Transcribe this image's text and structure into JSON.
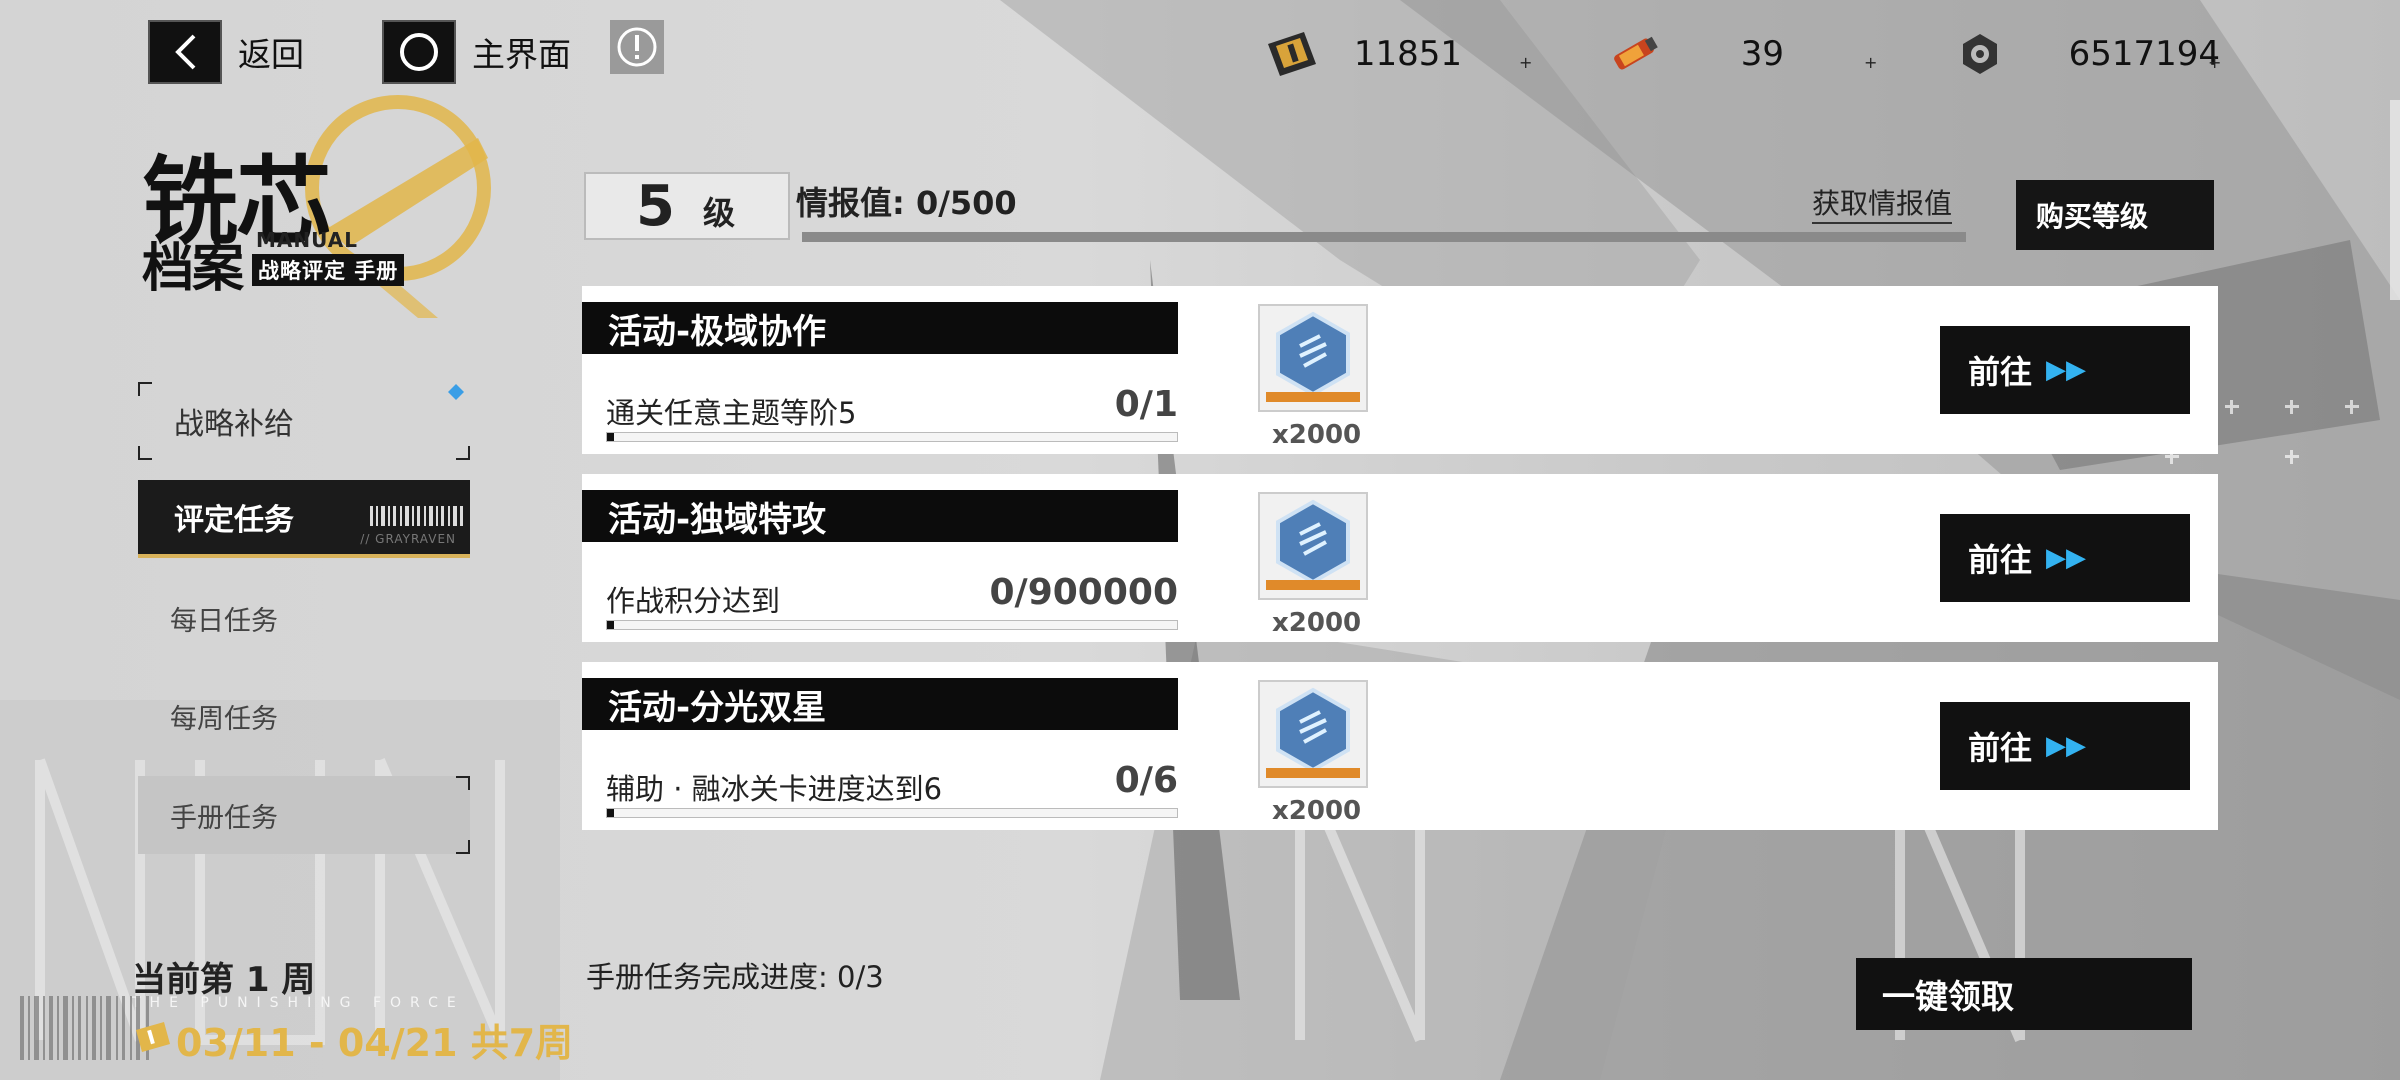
{
  "topbar": {
    "back_label": "返回",
    "home_label": "主界面",
    "resources": [
      {
        "icon": "ticket-icon",
        "value": "11851"
      },
      {
        "icon": "serum-vial-icon",
        "value": "39"
      },
      {
        "icon": "cog-coin-icon",
        "value": "6517194"
      }
    ]
  },
  "logo": {
    "title_line1": "铣芯",
    "title_line2": "档案",
    "manual": "MANUAL",
    "subtitle": "战略评定 手册"
  },
  "nav": {
    "supply": "战略补给",
    "eval": "评定任务",
    "eval_deco": "// GRAYRAVEN",
    "daily": "每日任务",
    "weekly": "每周任务",
    "manual": "手册任务"
  },
  "level": {
    "number": "5",
    "unit": "级",
    "intel_label": "情报值: 0/500",
    "intel_fraction": 0,
    "get_intel": "获取情报值",
    "buy_level": "购买等级"
  },
  "tasks": [
    {
      "title": "活动-极域协作",
      "desc": "通关任意主题等阶5",
      "progress": "0/1",
      "progress_fraction": 0,
      "reward_qty": "x2000",
      "go": "前往"
    },
    {
      "title": "活动-独域特攻",
      "desc": "作战积分达到",
      "progress": "0/900000",
      "progress_fraction": 0,
      "reward_qty": "x2000",
      "go": "前往"
    },
    {
      "title": "活动-分光双星",
      "desc": "辅助 · 融冰关卡进度达到6",
      "progress": "0/6",
      "progress_fraction": 0,
      "reward_qty": "x2000",
      "go": "前往"
    }
  ],
  "reward_icon": "supply-hexagon-icon",
  "footer": {
    "week_now": "当前第 1 周",
    "brand_tag": "THE PUNISHING FORCE",
    "dates": "03/11 - 04/21 共7周",
    "summary": "手册任务完成进度: 0/3",
    "claim_all": "一键领取"
  },
  "colors": {
    "accent_gold": "#d8b25a",
    "arrow_blue": "#33b2f0",
    "dark": "#111111"
  }
}
